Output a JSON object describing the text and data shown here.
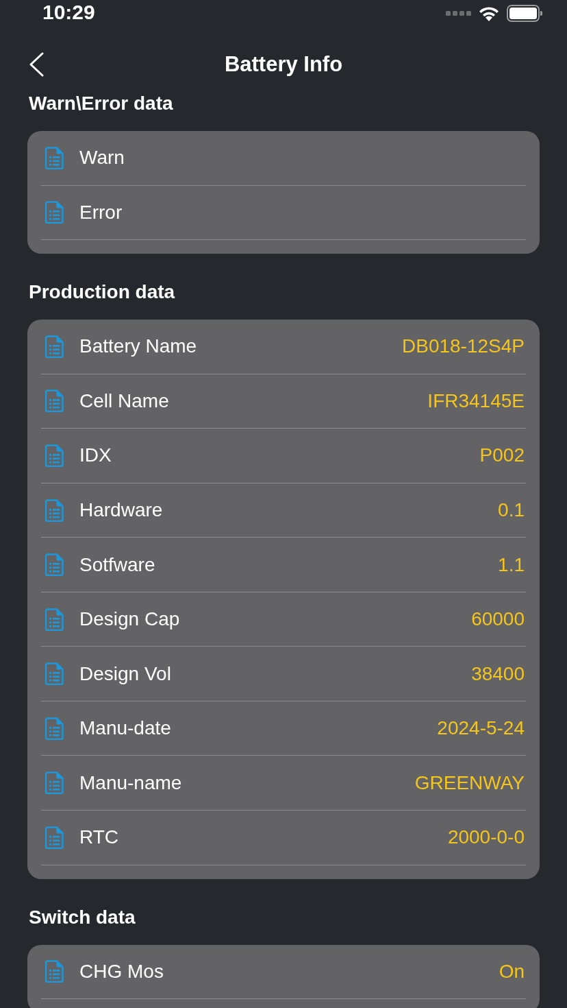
{
  "status_bar": {
    "time": "10:29"
  },
  "nav": {
    "title": "Battery Info"
  },
  "sections": [
    {
      "title": "Warn\\Error data",
      "rows": [
        {
          "label": "Warn"
        },
        {
          "label": "Error"
        }
      ]
    },
    {
      "title": "Production data",
      "rows": [
        {
          "label": "Battery Name",
          "value": "DB018-12S4P"
        },
        {
          "label": "Cell Name",
          "value": "IFR34145E"
        },
        {
          "label": "IDX",
          "value": "P002"
        },
        {
          "label": "Hardware",
          "value": "0.1"
        },
        {
          "label": "Sotfware",
          "value": "1.1"
        },
        {
          "label": "Design Cap",
          "value": "60000"
        },
        {
          "label": "Design Vol",
          "value": "38400"
        },
        {
          "label": "Manu-date",
          "value": "2024-5-24"
        },
        {
          "label": "Manu-name",
          "value": "GREENWAY"
        },
        {
          "label": "RTC",
          "value": "2000-0-0"
        }
      ]
    },
    {
      "title": "Switch data",
      "rows": [
        {
          "label": "CHG Mos",
          "value": "On"
        }
      ]
    }
  ]
}
